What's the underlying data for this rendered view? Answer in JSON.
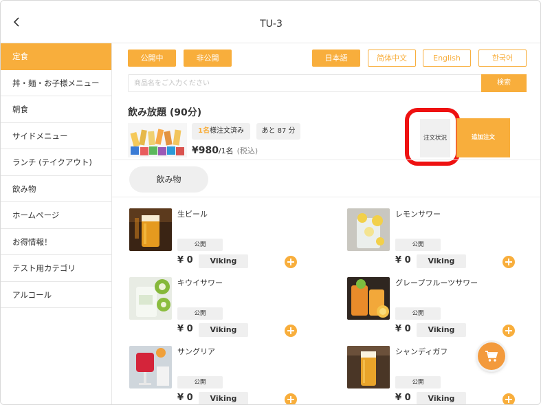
{
  "header": {
    "title": "TU-3",
    "back_icon": "chevron-left-icon"
  },
  "sidebar": {
    "items": [
      {
        "label": "定食",
        "active": true
      },
      {
        "label": "丼・麺・お子様メニュー"
      },
      {
        "label": "朝食"
      },
      {
        "label": "サイドメニュー"
      },
      {
        "label": "ランチ (テイクアウト)"
      },
      {
        "label": "飲み物"
      },
      {
        "label": "ホームページ"
      },
      {
        "label": "お得情報！"
      },
      {
        "label": "テスト用カテゴリ"
      },
      {
        "label": "アルコール"
      }
    ]
  },
  "toolbar": {
    "public_label": "公開中",
    "private_label": "非公開",
    "languages": [
      "日本語",
      "简体中文",
      "English",
      "한국어"
    ]
  },
  "search": {
    "placeholder": "商品名をご入力ください",
    "button_label": "検索"
  },
  "plan": {
    "title": "飲み放題 (90分)",
    "ordered_count": "1名",
    "ordered_suffix": "様注文済み",
    "remaining": "あと 87 分",
    "price": "¥980",
    "per": "/1名",
    "tax": "(税込)",
    "status_button": "注文状況",
    "add_button": "追加注文"
  },
  "category_pill": "飲み物",
  "products": [
    {
      "name": "生ビール",
      "status": "公開",
      "price": "¥ 0",
      "tag": "Viking",
      "image_icon": "beer-glass-icon"
    },
    {
      "name": "レモンサワー",
      "status": "公開",
      "price": "¥ 0",
      "tag": "Viking",
      "image_icon": "lemon-sour-icon"
    },
    {
      "name": "キウイサワー",
      "status": "公開",
      "price": "¥ 0",
      "tag": "Viking",
      "image_icon": "kiwi-sour-icon"
    },
    {
      "name": "グレープフルーツサワー",
      "status": "公開",
      "price": "¥ 0",
      "tag": "Viking",
      "image_icon": "grapefruit-sour-icon"
    },
    {
      "name": "サングリア",
      "status": "公開",
      "price": "¥ 0",
      "tag": "Viking",
      "image_icon": "sangria-icon"
    },
    {
      "name": "シャンディガフ",
      "status": "公開",
      "price": "¥ 0",
      "tag": "Viking",
      "image_icon": "shandygaff-icon"
    }
  ],
  "colors": {
    "accent": "#f8ae3c",
    "highlight_ring": "#ee1111",
    "cart_button": "#f39a3c"
  },
  "cart_icon": "cart-icon"
}
